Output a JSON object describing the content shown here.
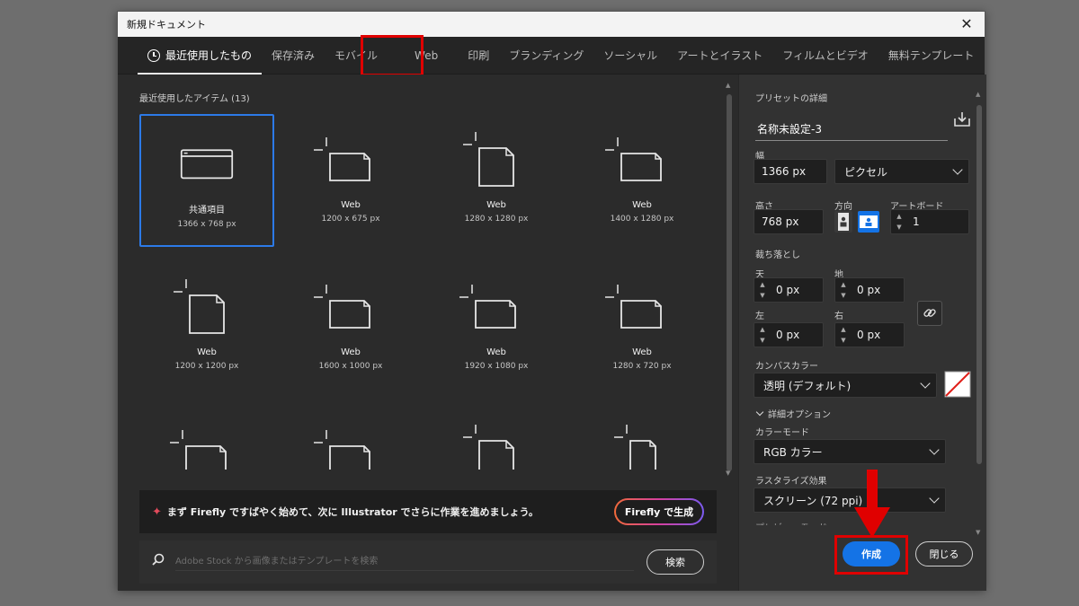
{
  "window": {
    "title": "新規ドキュメント",
    "close_glyph": "✕"
  },
  "tabs": [
    {
      "label": "最近使用したもの",
      "active": true
    },
    {
      "label": "保存済み"
    },
    {
      "label": "モバイル"
    },
    {
      "label": "Web",
      "highlighted": true
    },
    {
      "label": "印刷"
    },
    {
      "label": "ブランディング"
    },
    {
      "label": "ソーシャル"
    },
    {
      "label": "アートとイラスト"
    },
    {
      "label": "フィルムとビデオ"
    },
    {
      "label": "無料テンプレート"
    }
  ],
  "recent": {
    "title": "最近使用したアイテム (13)",
    "items": [
      {
        "name": "共通項目",
        "size": "1366 x 768 px",
        "selected": true,
        "icon": "browser-window-icon"
      },
      {
        "name": "Web",
        "size": "1200 x 675 px",
        "icon": "landscape-doc-icon"
      },
      {
        "name": "Web",
        "size": "1280 x 1280 px",
        "icon": "square-doc-icon"
      },
      {
        "name": "Web",
        "size": "1400 x 1280 px",
        "icon": "landscape-doc-icon"
      },
      {
        "name": "Web",
        "size": "1200 x 1200 px",
        "icon": "square-doc-icon"
      },
      {
        "name": "Web",
        "size": "1600 x 1000 px",
        "icon": "landscape-doc-icon"
      },
      {
        "name": "Web",
        "size": "1920 x 1080 px",
        "icon": "landscape-doc-icon"
      },
      {
        "name": "Web",
        "size": "1280 x 720 px",
        "icon": "landscape-doc-icon"
      },
      {
        "name": "",
        "size": "",
        "icon": "landscape-doc-icon"
      },
      {
        "name": "",
        "size": "",
        "icon": "landscape-doc-icon"
      },
      {
        "name": "",
        "size": "",
        "icon": "square-doc-icon"
      },
      {
        "name": "",
        "size": "",
        "icon": "portrait-doc-icon"
      }
    ]
  },
  "firefly": {
    "message": "まず Firefly ですばやく始めて、次に Illustrator でさらに作業を進めましょう。",
    "button": "Firefly で生成"
  },
  "search": {
    "placeholder": "Adobe Stock から画像またはテンプレートを検索",
    "button": "検索"
  },
  "preset": {
    "title": "プリセットの詳細",
    "name": "名称未設定-3",
    "width_label": "幅",
    "width": "1366 px",
    "unit": "ピクセル",
    "height_label": "高さ",
    "height": "768 px",
    "orientation_label": "方向",
    "artboard_label": "アートボード",
    "artboards": "1",
    "bleed_label": "裁ち落とし",
    "bleed": {
      "top_label": "天",
      "top": "0 px",
      "bottom_label": "地",
      "bottom": "0 px",
      "left_label": "左",
      "left": "0 px",
      "right_label": "右",
      "right": "0 px"
    },
    "canvas_color_label": "カンバスカラー",
    "canvas_color": "透明 (デフォルト)",
    "advanced_label": "詳細オプション",
    "color_mode_label": "カラーモード",
    "color_mode": "RGB カラー",
    "raster_label": "ラスタライズ効果",
    "raster": "スクリーン (72 ppi)",
    "preview_label": "プレビューモード"
  },
  "actions": {
    "create": "作成",
    "close": "閉じる"
  },
  "colors": {
    "accent": "#1473e6",
    "highlight": "#e00000",
    "selection": "#2c7ae8"
  }
}
